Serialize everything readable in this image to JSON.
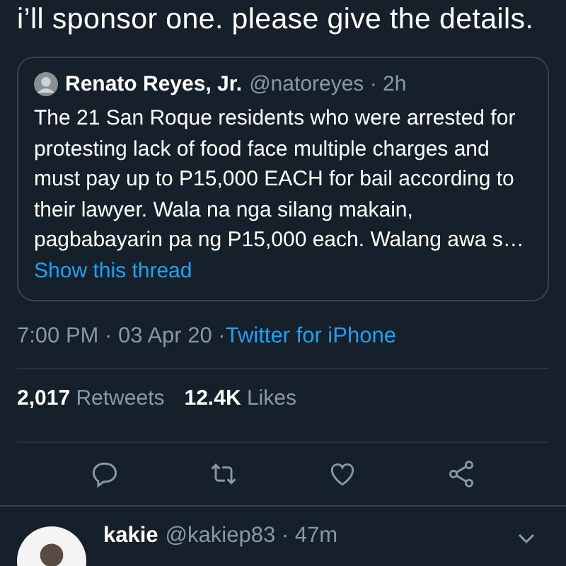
{
  "tweet": {
    "text": "i’ll sponsor one. please give the details.",
    "quote": {
      "name": "Renato Reyes, Jr.",
      "handle": "@natoreyes · 2h",
      "text": "The 21 San Roque residents who were arrested for protesting lack of food face multiple charges and must pay up to P15,000 EACH for bail according to their lawyer.  Wala na nga silang makain, pagbabayarin pa ng P15,000 each. Walang awa s…",
      "thread_link": "Show this thread"
    },
    "meta": "7:00 PM · 03 Apr 20 · ",
    "source": "Twitter for iPhone",
    "stats": [
      {
        "count": "2,017",
        "label": "Retweets"
      },
      {
        "count": "12.4K",
        "label": "Likes"
      }
    ],
    "actions": [
      {
        "kind": "reply"
      },
      {
        "kind": "retweet"
      },
      {
        "kind": "like"
      },
      {
        "kind": "share"
      }
    ]
  },
  "reply": {
    "name": "kakie",
    "handle": "@kakiep83 · 47m"
  }
}
